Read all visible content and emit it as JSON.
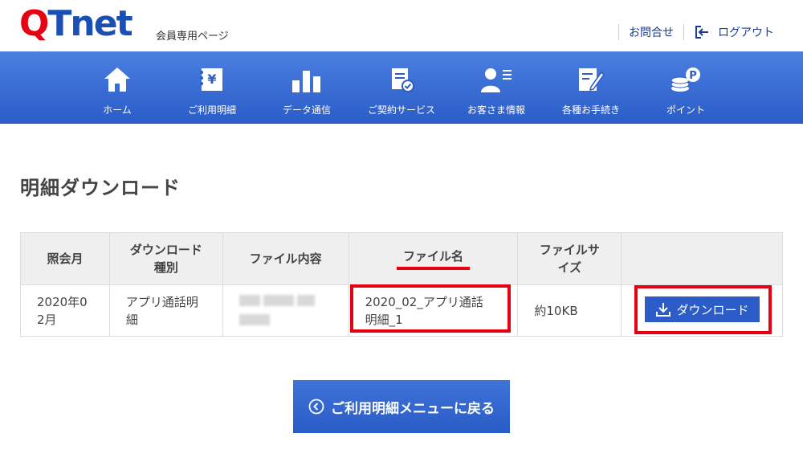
{
  "header": {
    "logo_q": "Q",
    "logo_t": "T",
    "logo_net": "net",
    "member_label": "会員専用ページ",
    "contact": "お問合せ",
    "logout": "ログアウト"
  },
  "nav": {
    "items": [
      {
        "label": "ホーム",
        "icon": "home-icon"
      },
      {
        "label": "ご利用明細",
        "icon": "usage-statement-icon"
      },
      {
        "label": "データ通信",
        "icon": "bar-chart-icon"
      },
      {
        "label": "ご契約サービス",
        "icon": "contract-document-icon"
      },
      {
        "label": "お客さま情報",
        "icon": "user-info-icon"
      },
      {
        "label": "各種お手続き",
        "icon": "form-edit-icon"
      },
      {
        "label": "ポイント",
        "icon": "points-coin-icon"
      }
    ]
  },
  "page": {
    "title": "明細ダウンロード"
  },
  "table": {
    "headers": [
      "照会月",
      "ダウンロード\n種別",
      "ファイル内容",
      "ファイル名",
      "ファイルサ\nイズ",
      ""
    ],
    "header_lines": {
      "h1": "照会月",
      "h2a": "ダウンロード",
      "h2b": "種別",
      "h3": "ファイル内容",
      "h4": "ファイル名",
      "h5a": "ファイルサ",
      "h5b": "イズ"
    },
    "rows": [
      {
        "month_a": "2020年0",
        "month_b": "2月",
        "type_a": "アプリ通話明",
        "type_b": "細",
        "filename_a": "2020_02_アプリ通話",
        "filename_b": "明細_1",
        "size": "約10KB",
        "download_label": "ダウンロード"
      }
    ]
  },
  "back_button": {
    "label": "ご利用明細メニューに戻る"
  },
  "colors": {
    "brand_red": "#e60012",
    "brand_blue": "#2b5cc8",
    "nav_top": "#4a7fe0"
  }
}
